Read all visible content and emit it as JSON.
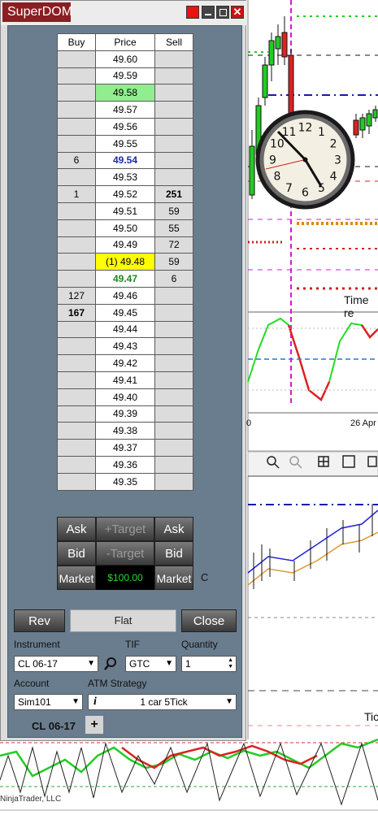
{
  "window": {
    "title": "SuperDOM"
  },
  "ladder": {
    "headers": {
      "buy": "Buy",
      "price": "Price",
      "sell": "Sell"
    },
    "rows": [
      {
        "buy": "",
        "price": "49.60",
        "sell": "",
        "style": ""
      },
      {
        "buy": "",
        "price": "49.59",
        "sell": "",
        "style": ""
      },
      {
        "buy": "",
        "price": "49.58",
        "sell": "",
        "style": "green"
      },
      {
        "buy": "",
        "price": "49.57",
        "sell": "",
        "style": ""
      },
      {
        "buy": "",
        "price": "49.56",
        "sell": "",
        "style": ""
      },
      {
        "buy": "",
        "price": "49.55",
        "sell": "",
        "style": ""
      },
      {
        "buy": "6",
        "price": "49.54",
        "sell": "",
        "style": "blue"
      },
      {
        "buy": "",
        "price": "49.53",
        "sell": "",
        "style": ""
      },
      {
        "buy": "1",
        "price": "49.52",
        "sell": "251",
        "style": "sellbold"
      },
      {
        "buy": "",
        "price": "49.51",
        "sell": "59",
        "style": ""
      },
      {
        "buy": "",
        "price": "49.50",
        "sell": "55",
        "style": ""
      },
      {
        "buy": "",
        "price": "49.49",
        "sell": "72",
        "style": ""
      },
      {
        "buy": "",
        "price": "(1) 49.48",
        "sell": "59",
        "style": "yellow"
      },
      {
        "buy": "",
        "price": "49.47",
        "sell": "6",
        "style": "greentext"
      },
      {
        "buy": "127",
        "price": "49.46",
        "sell": "",
        "style": ""
      },
      {
        "buy": "167",
        "price": "49.45",
        "sell": "",
        "style": "buybold"
      },
      {
        "buy": "",
        "price": "49.44",
        "sell": "",
        "style": ""
      },
      {
        "buy": "",
        "price": "49.43",
        "sell": "",
        "style": ""
      },
      {
        "buy": "",
        "price": "49.42",
        "sell": "",
        "style": ""
      },
      {
        "buy": "",
        "price": "49.41",
        "sell": "",
        "style": ""
      },
      {
        "buy": "",
        "price": "49.40",
        "sell": "",
        "style": ""
      },
      {
        "buy": "",
        "price": "49.39",
        "sell": "",
        "style": ""
      },
      {
        "buy": "",
        "price": "49.38",
        "sell": "",
        "style": ""
      },
      {
        "buy": "",
        "price": "49.37",
        "sell": "",
        "style": ""
      },
      {
        "buy": "",
        "price": "49.36",
        "sell": "",
        "style": ""
      },
      {
        "buy": "",
        "price": "49.35",
        "sell": "",
        "style": ""
      }
    ]
  },
  "buttons": {
    "ask_left": "Ask",
    "target_plus": "+Target",
    "ask_right": "Ask",
    "bid_left": "Bid",
    "target_minus": "-Target",
    "bid_right": "Bid",
    "market_left": "Market",
    "pnl": "$100.00",
    "market_right": "Market",
    "c_label": "C",
    "rev": "Rev",
    "flat": "Flat",
    "close": "Close"
  },
  "form": {
    "instrument_label": "Instrument",
    "instrument_value": "CL 06-17",
    "tif_label": "TIF",
    "tif_value": "GTC",
    "quantity_label": "Quantity",
    "quantity_value": "1",
    "account_label": "Account",
    "account_value": "Sim101",
    "atm_label": "ATM Strategy",
    "atm_value": "1 car 5Tick",
    "atm_info_icon": "i"
  },
  "tabs": {
    "active": "CL 06-17",
    "add": "+"
  },
  "background_chart": {
    "time_label": "Time re",
    "date_label": "26 Apr",
    "zero_label": "0",
    "tick_label": "Tic",
    "copyright": "NinjaTrader, LLC"
  },
  "clock": {
    "numerals": [
      "12",
      "1",
      "2",
      "3",
      "4",
      "5",
      "6",
      "7",
      "8",
      "9",
      "10",
      "11"
    ]
  },
  "colors": {
    "title_tab": "#8b1e22",
    "panel": "#6a7d8e",
    "pnl_bg": "#000000",
    "pnl_text": "#2fd62f",
    "last_green": "#90ee90",
    "yellow": "#ffff00"
  }
}
